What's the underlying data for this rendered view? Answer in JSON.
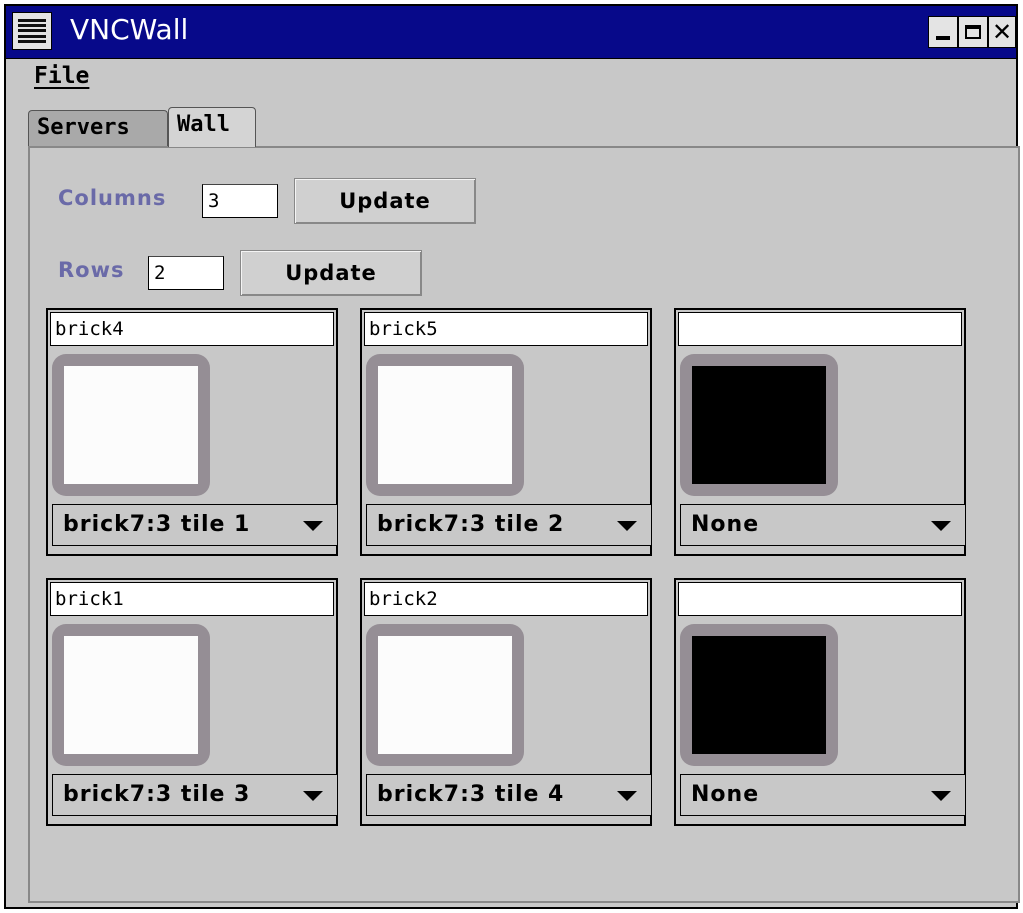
{
  "window": {
    "title": "VNCWall"
  },
  "menubar": {
    "file": "File"
  },
  "tabs": [
    "Servers",
    "Wall"
  ],
  "controls": {
    "columns_label": "Columns",
    "columns_value": "3",
    "rows_label": "Rows",
    "rows_value": "2",
    "update_label": "Update"
  },
  "tiles": [
    {
      "name": "brick4",
      "source": "brick7:3 tile 1",
      "preview_color": "#fcfcfc"
    },
    {
      "name": "brick5",
      "source": "brick7:3 tile 2",
      "preview_color": "#fcfcfc"
    },
    {
      "name": "",
      "source": "None",
      "preview_color": "#000000"
    },
    {
      "name": "brick1",
      "source": "brick7:3 tile 3",
      "preview_color": "#fcfcfc"
    },
    {
      "name": "brick2",
      "source": "brick7:3 tile 4",
      "preview_color": "#fcfcfc"
    },
    {
      "name": "",
      "source": "None",
      "preview_color": "#000000"
    }
  ],
  "colors": {
    "titlebar": "#07098a",
    "label": "#6a6aa8",
    "background": "#c8c8c8"
  }
}
